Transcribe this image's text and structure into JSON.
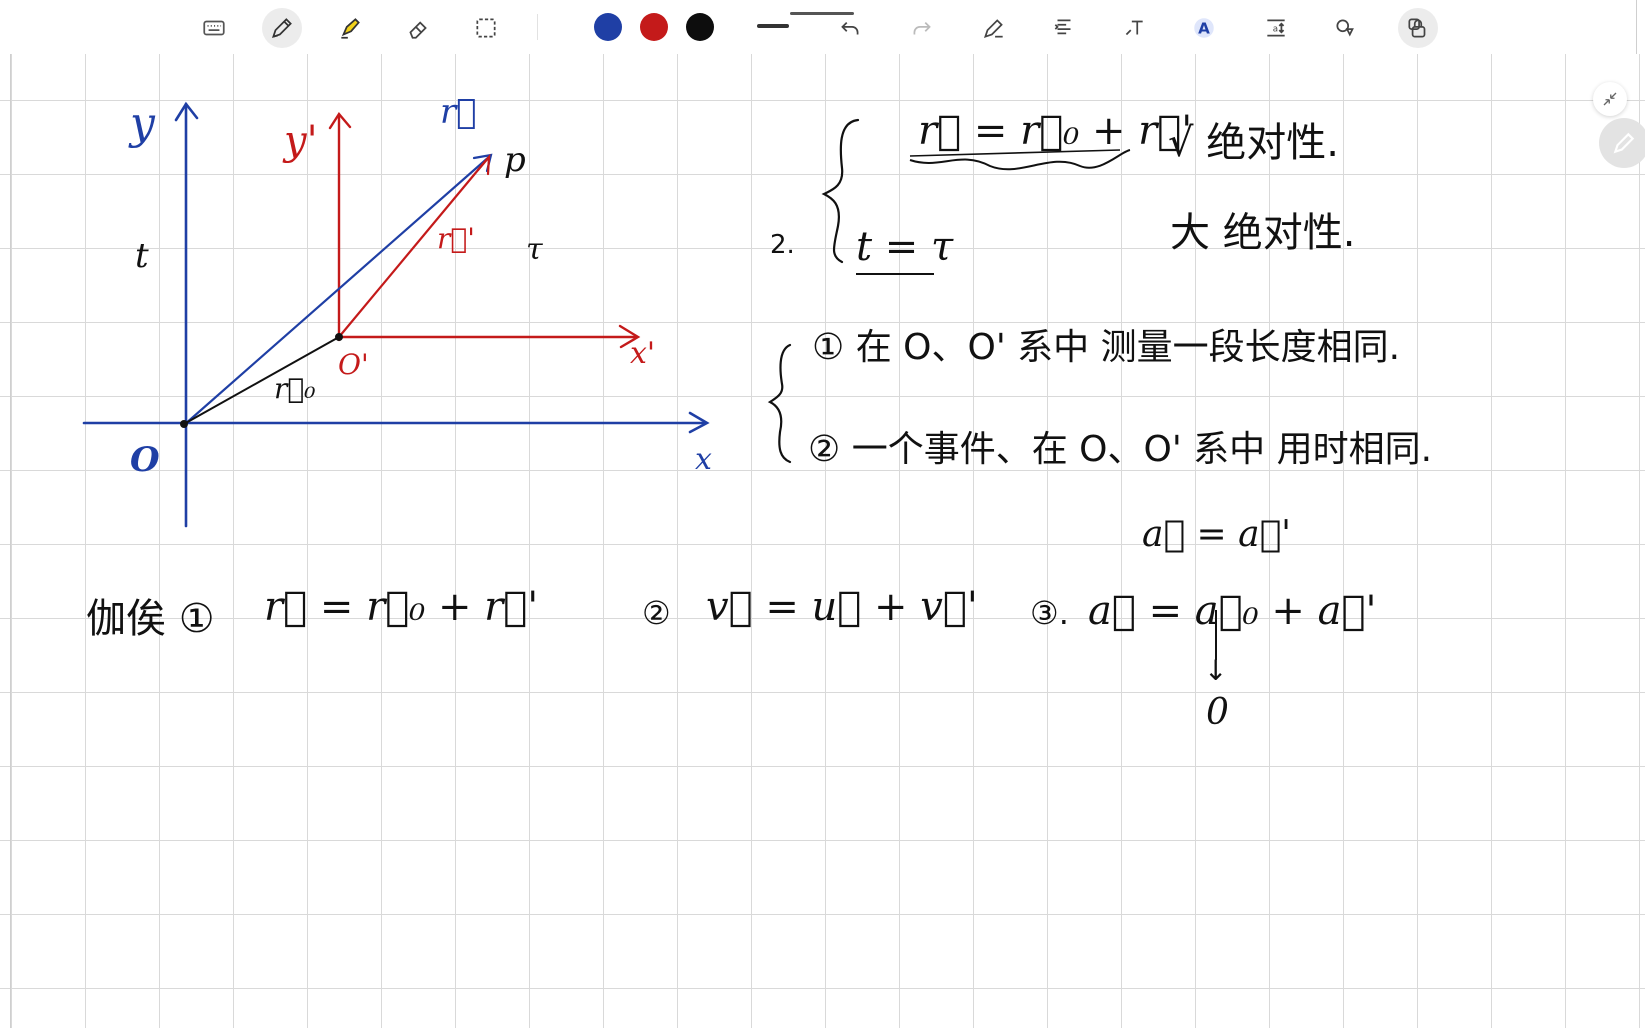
{
  "toolbar": {
    "tools": [
      {
        "name": "keyboard-icon"
      },
      {
        "name": "pen-icon",
        "active": true
      },
      {
        "name": "highlighter-icon"
      },
      {
        "name": "eraser-icon"
      },
      {
        "name": "lasso-select-icon"
      }
    ],
    "colors": [
      "#1f3fa5",
      "#c41a1a",
      "#0d0d0d"
    ],
    "actions": [
      "undo-icon",
      "redo-icon",
      "shape-pen-icon",
      "text-align-icon",
      "text-icon",
      "highlight-text-icon",
      "spacing-icon",
      "shapes-icon",
      "lock-icon"
    ]
  },
  "diagram": {
    "axis_labels": {
      "y": "y",
      "x": "x",
      "origin": "O",
      "yp": "y'",
      "xp": "x'",
      "op": "O'",
      "p": "p"
    },
    "vector_labels": {
      "r": "r⃗",
      "rp": "r⃗'",
      "r0": "r⃗₀"
    },
    "time_labels": {
      "t": "t",
      "tau": "τ"
    }
  },
  "notes": {
    "line1": "r⃗ = r⃗₀ + r⃗'",
    "line1_mark": "√ 绝对性.",
    "line2_prefix": "2.",
    "line2": "t = τ",
    "line2_mark": "大 绝对性.",
    "item1": "① 在 O、O' 系中 测量一段长度相同.",
    "item2": "② 一个事件、在 O、O' 系中 用时相同.",
    "accel_eq": "a⃗ = a⃗'",
    "bottom_prefix": "伽俟 ①",
    "eq1": "r⃗ = r⃗₀ + r⃗'",
    "eq2_prefix": "②",
    "eq2": "v⃗ = u⃗ + v⃗'",
    "eq3_prefix": "③.",
    "eq3": "a⃗ = a⃗₀ + a⃗'",
    "arrow_down": "↓",
    "zero": "0"
  }
}
